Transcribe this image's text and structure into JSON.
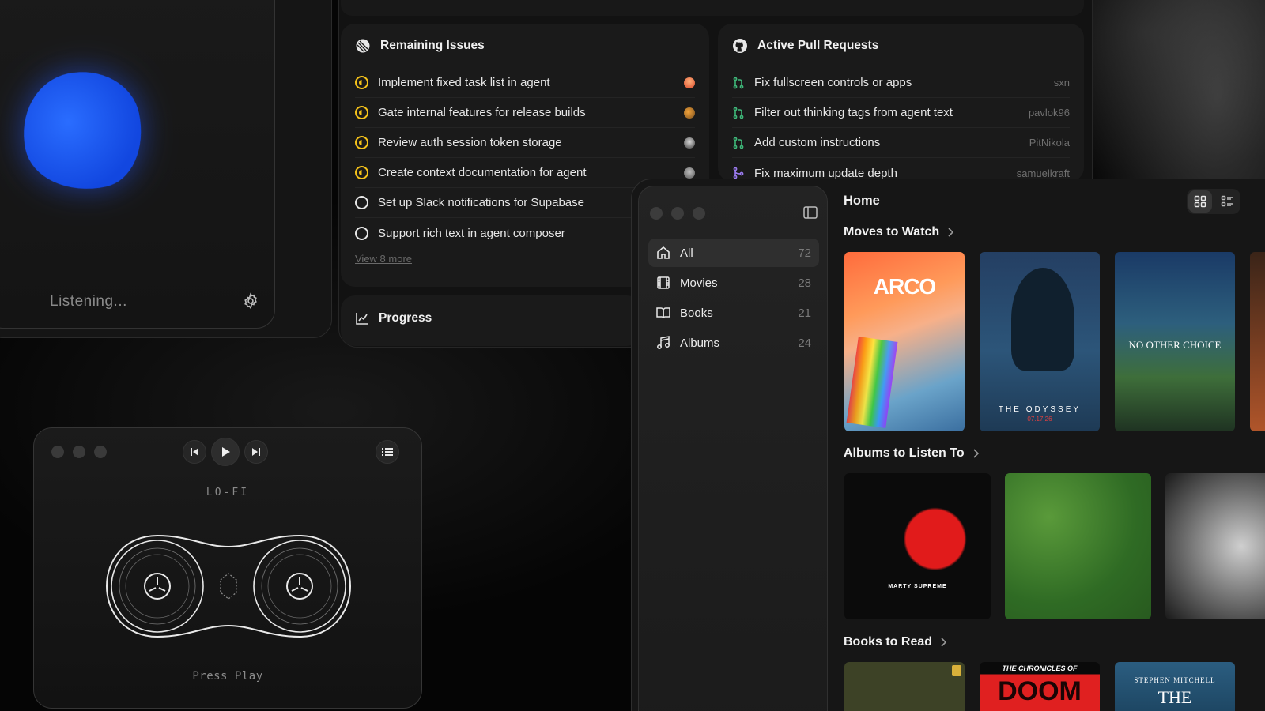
{
  "listening": {
    "status": "Listening..."
  },
  "issues": {
    "title": "Remaining Issues",
    "items": [
      {
        "label": "Implement fixed task list in agent",
        "state": "in-progress"
      },
      {
        "label": "Gate internal features for release builds",
        "state": "in-progress"
      },
      {
        "label": "Review auth session token storage",
        "state": "in-progress"
      },
      {
        "label": "Create context documentation for agent",
        "state": "in-progress"
      },
      {
        "label": "Set up Slack notifications for Supabase",
        "state": "todo"
      },
      {
        "label": "Support rich text in agent composer",
        "state": "todo"
      }
    ],
    "view_more": "View 8 more"
  },
  "pull_requests": {
    "title": "Active Pull Requests",
    "items": [
      {
        "label": "Fix fullscreen controls or apps",
        "author": "sxn"
      },
      {
        "label": "Filter out thinking tags from agent text",
        "author": "pavlok96"
      },
      {
        "label": "Add custom instructions",
        "author": "PitNikola"
      },
      {
        "label": "Fix maximum update depth",
        "author": "samuelkraft"
      }
    ]
  },
  "progress": {
    "title": "Progress"
  },
  "player": {
    "station": "LO-FI",
    "status": "Press Play"
  },
  "library": {
    "nav": [
      {
        "label": "All",
        "count": "72",
        "icon": "home-icon"
      },
      {
        "label": "Movies",
        "count": "28",
        "icon": "film-icon"
      },
      {
        "label": "Books",
        "count": "21",
        "icon": "book-icon"
      },
      {
        "label": "Albums",
        "count": "24",
        "icon": "music-note-icon"
      }
    ],
    "title": "Home",
    "sections": {
      "movies": "Moves to Watch",
      "albums": "Albums to Listen To",
      "books": "Books to Read"
    },
    "posters": {
      "arco": "ARCO",
      "odyssey": "THE ODYSSEY",
      "odyssey_date": "07.17.26",
      "no_other": "NO OTHER CHOICE",
      "marty": "MARTY SUPREME",
      "doom": "THE CHRONICLES OF",
      "doom_big": "DOOM",
      "stephen": "STEPHEN MITCHELL",
      "the": "THE"
    }
  }
}
